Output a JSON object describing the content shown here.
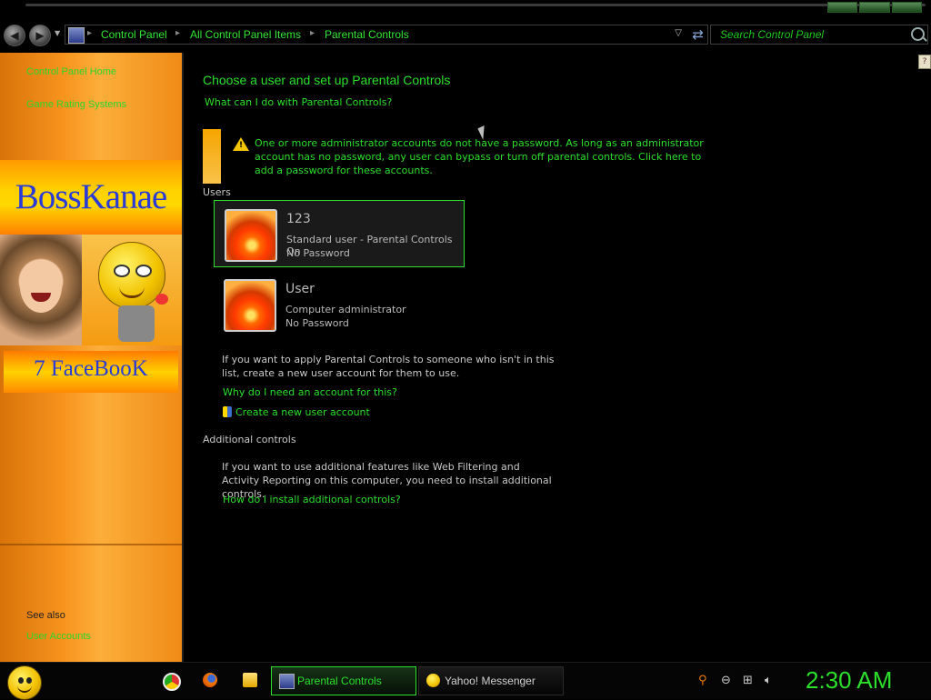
{
  "breadcrumbs": [
    "Control Panel",
    "All Control Panel Items",
    "Parental Controls"
  ],
  "search": {
    "placeholder": "Search Control Panel"
  },
  "sidebar": {
    "links": [
      "Control Panel Home",
      "Game Rating Systems"
    ],
    "banner_title": "BossKanae",
    "banner_subtitle": "7 FaceBooK",
    "see_also_label": "See also",
    "see_also_links": [
      "User Accounts"
    ]
  },
  "main": {
    "heading": "Choose a user and set up Parental Controls",
    "what_link": "What can I do with Parental Controls?",
    "warning_text": "One or more administrator accounts do not have a password. As long as an administrator account has no password, any user can bypass or turn off parental controls. Click here to add a password for these accounts.",
    "users_label": "Users",
    "users": [
      {
        "name": "123",
        "type": "Standard user - Parental Controls On",
        "password": "No Password"
      },
      {
        "name": "User",
        "type": "Computer administrator",
        "password": "No Password"
      }
    ],
    "apply_text": "If you want to apply Parental Controls to someone who isn't in this list, create a new user account for them to use.",
    "why_link": "Why do I need an account for this?",
    "create_link": "Create a new user account",
    "additional_label": "Additional controls",
    "additional_text": "If you want to use additional features like Web Filtering and Activity Reporting on this computer, you need to install additional controls.",
    "install_link": "How do I install additional controls?"
  },
  "taskbar": {
    "tasks": [
      {
        "label": "Parental Controls",
        "active": true
      },
      {
        "label": "Yahoo! Messenger",
        "active": false
      }
    ],
    "clock": "2:30 AM"
  },
  "colors": {
    "accent": "#2bdf2b",
    "sidebar": "#f7941d",
    "background": "#000000"
  },
  "icons": [
    "back-icon",
    "forward-icon",
    "control-panel-icon",
    "refresh-icon",
    "search-icon",
    "help-icon",
    "warning-icon",
    "user-picture-icon",
    "shield-icon",
    "chrome-icon",
    "firefox-icon",
    "folder-icon",
    "messenger-icon",
    "magnifier-icon",
    "network-icon",
    "volume-icon"
  ]
}
